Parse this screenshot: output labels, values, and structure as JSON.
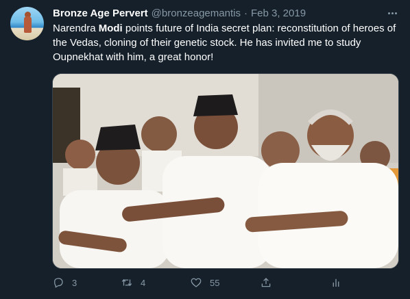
{
  "tweet": {
    "display_name": "Bronze Age Pervert",
    "handle": "@bronzeagemantis",
    "separator": "·",
    "date": "Feb 3, 2019",
    "text_before": "Narendra ",
    "text_bold": "Modi",
    "text_after": " points future of India secret plan: reconstitution of heroes of the Vedas, cloning of their genetic stock. He has invited me to study Oupnekhat with him, a great honor!"
  },
  "actions": {
    "reply_count": "3",
    "retweet_count": "4",
    "like_count": "55",
    "reply_icon": "reply-icon",
    "retweet_icon": "retweet-icon",
    "like_icon": "heart-icon",
    "share_icon": "share-icon",
    "analytics_icon": "analytics-icon"
  },
  "colors": {
    "background": "#15202b",
    "text_primary": "#ffffff",
    "text_secondary": "#8899a6",
    "border": "#38444d"
  }
}
